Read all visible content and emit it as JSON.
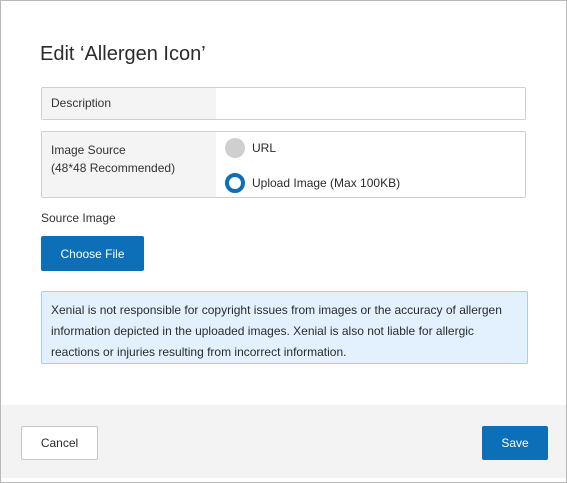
{
  "dialog": {
    "title": "Edit ‘Allergen Icon’"
  },
  "form": {
    "description": {
      "label": "Description",
      "value": ""
    },
    "image_source": {
      "label_line1": "Image Source",
      "label_line2": "(48*48 Recommended)",
      "options": [
        {
          "label": "URL",
          "selected": false
        },
        {
          "label": "Upload Image (Max 100KB)",
          "selected": true
        }
      ]
    },
    "source_image": {
      "label": "Source Image",
      "button_label": "Choose File"
    },
    "disclaimer": "Xenial is not responsible for copyright issues from images or the accuracy of allergen information depicted in the uploaded images. Xenial is also not liable for allergic reactions or injuries resulting from incorrect information."
  },
  "footer": {
    "cancel_label": "Cancel",
    "save_label": "Save"
  },
  "colors": {
    "primary": "#0d6fb8",
    "disclaimer_bg": "#e3f0fd",
    "disclaimer_border": "#a8cdef",
    "footer_bg": "#f3f3f3",
    "label_bg": "#f4f4f4"
  }
}
